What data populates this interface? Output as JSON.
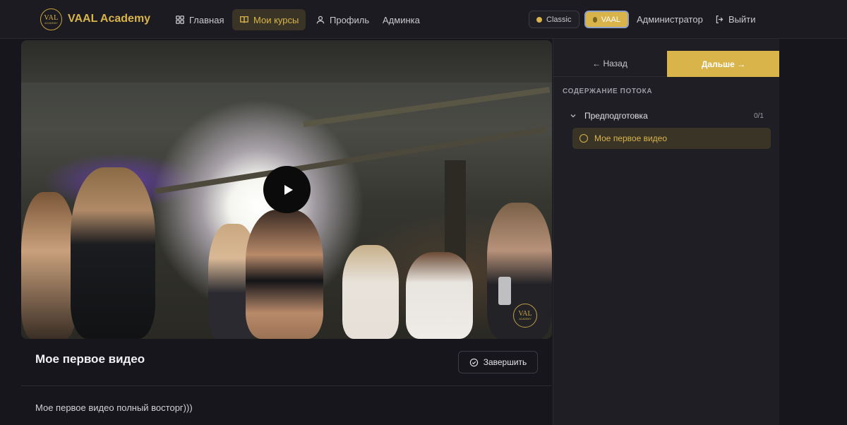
{
  "brand": {
    "logo_text": "VAL",
    "logo_subtext": "ACADEMY",
    "name": "VAAL Academy"
  },
  "nav": {
    "items": [
      {
        "label": "Главная",
        "icon": "grid-icon"
      },
      {
        "label": "Мои курсы",
        "icon": "book-icon",
        "active": true
      },
      {
        "label": "Профиль",
        "icon": "user-icon"
      },
      {
        "label": "Админка",
        "icon": ""
      }
    ]
  },
  "header_right": {
    "theme_classic": "Classic",
    "theme_vaal": "VAAL",
    "admin": "Администратор",
    "logout": "Выйти"
  },
  "video": {
    "watermark_text": "VAL",
    "watermark_subtext": "ACADEMY",
    "play_icon": "play-icon"
  },
  "lesson": {
    "title": "Мое первое видео",
    "complete_label": "Завершить",
    "description": "Мое первое видео полный восторг)))"
  },
  "sidebar": {
    "back_label": "← Назад",
    "next_label": "Дальше →",
    "section_title": "СОДЕРЖАНИЕ ПОТОКА",
    "module": {
      "title": "Предподготовка",
      "progress": "0/1"
    },
    "lessons": [
      {
        "label": "Мое первое видео",
        "active": true
      }
    ]
  },
  "colors": {
    "accent": "#d9b44a",
    "background": "#16161c",
    "panel": "#1e1e24"
  }
}
